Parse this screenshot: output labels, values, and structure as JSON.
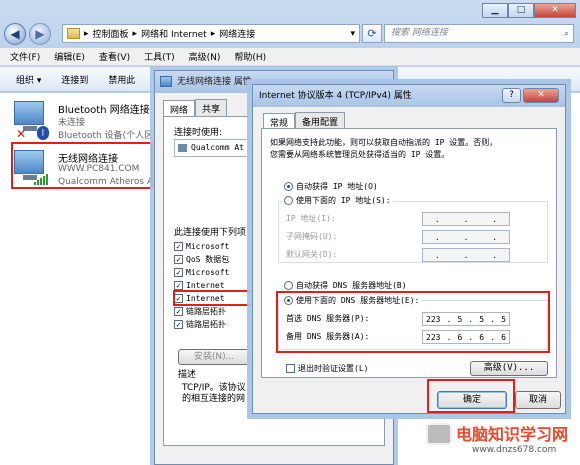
{
  "explorer": {
    "breadcrumb": [
      "控制面板",
      "网络和 Internet",
      "网络连接"
    ],
    "search_placeholder": "搜索 网络连接",
    "window_controls": {
      "minimize": "▁",
      "maximize": "□",
      "close": "✕"
    },
    "nav": {
      "back": "◀",
      "forward": "▶"
    },
    "menu": [
      "文件(F)",
      "编辑(E)",
      "查看(V)",
      "工具(T)",
      "高级(N)",
      "帮助(H)"
    ],
    "toolbar": [
      "组织 ▾",
      "连接到",
      "禁用此"
    ],
    "connections": [
      {
        "name": "Bluetooth 网络连接",
        "status": "未连接",
        "device": "Bluetooth 设备(个人区"
      },
      {
        "name": "无线网络连接",
        "status": "WWW.PC841.COM",
        "device": "Qualcomm Atheros A"
      }
    ]
  },
  "props": {
    "title": "无线网络连接 属性",
    "tabs": [
      "网络",
      "共享"
    ],
    "connect_using_label": "连接时使用:",
    "adapter": "Qualcomm At",
    "items_label": "此连接使用下列项",
    "items": [
      "Microsoft",
      "QoS 数据包",
      "Microsoft",
      "Internet",
      "Internet",
      "链路层拓扑",
      "链路层拓扑"
    ],
    "install_button": "安装(N)...",
    "description_label": "描述",
    "description": [
      "TCP/IP。该协议",
      "的相互连接的网"
    ]
  },
  "ipv4": {
    "title": "Internet 协议版本 4 (TCP/IPv4) 属性",
    "help_button": "?",
    "close_button": "✕",
    "tabs": [
      "常规",
      "备用配置"
    ],
    "intro": [
      "如果网络支持此功能，则可以获取自动指派的 IP 设置。否则，",
      "您需要从网络系统管理员处获得适当的 IP 设置。"
    ],
    "auto_ip": "自动获得 IP 地址(O)",
    "manual_ip": "使用下面的 IP 地址(S):",
    "ip_label": "IP 地址(I):",
    "mask_label": "子网掩码(U):",
    "gateway_label": "默认网关(D):",
    "auto_dns": "自动获得 DNS 服务器地址(B)",
    "manual_dns": "使用下面的 DNS 服务器地址(E):",
    "preferred_dns_label": "首选 DNS 服务器(P):",
    "preferred_dns": [
      "223",
      "5",
      "5",
      "5"
    ],
    "alternate_dns_label": "备用 DNS 服务器(A):",
    "alternate_dns": [
      "223",
      "6",
      "6",
      "6"
    ],
    "validate_label": "退出时验证设置(L)",
    "advanced_button": "高级(V)...",
    "ok_button": "确定",
    "cancel_button": "取消"
  },
  "watermark": {
    "title": "电脑知识学习网",
    "url": "www.dnzs678.com"
  },
  "colors": {
    "highlight": "#e0201d",
    "title_bar": "#b8cfeb"
  }
}
